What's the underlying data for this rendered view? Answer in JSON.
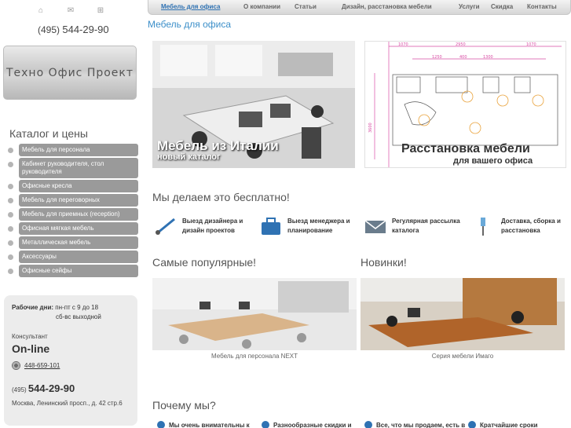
{
  "sidebar": {
    "phone_prefix": "(495)",
    "phone_number": "544-29-90",
    "logo_text": "Техно Офис Проект",
    "catalog_title": "Каталог и цены",
    "menu": [
      "Мебель для персонала",
      "Кабинет руководителя, стол руководителя",
      "Офисные кресла",
      "Мебель для переговорных",
      "Мебель для приемных (reception)",
      "Офисная мягкая мебель",
      "Металлическая мебель",
      "Аксессуары",
      "Офисные сейфы"
    ],
    "hours_label": "Рабочие дни:",
    "hours_weekdays": "пн-пт с 9 до 18",
    "hours_weekend": "сб-вс выходной",
    "consultant_label": "Консультант",
    "online_label": "On-line",
    "icq_number": "448-659-101",
    "phone2_prefix": "(495)",
    "phone2_number": "544-29-90",
    "address": "Москва, Ленинский просп., д. 42 стр.6"
  },
  "topnav": {
    "items": [
      "Мебель для офиса",
      "О компании",
      "Статьи",
      "Дизайн, расстановка мебели",
      "Услуги",
      "Скидка",
      "Контакты"
    ]
  },
  "page_title": "Мебель для офиса",
  "banners": {
    "left_title": "Мебель из Италии",
    "left_subtitle": "новый каталог",
    "right_title": "Расстановка мебели",
    "right_subtitle": "для вашего офиса",
    "plan_dims": [
      "1070",
      "2950",
      "1070",
      "1250",
      "400",
      "1300",
      "3600"
    ]
  },
  "free": {
    "heading": "Мы делаем это бесплатно!",
    "services": [
      "Выезд дизайнера и дизайн проектов",
      "Выезд менеджера и планирование",
      "Регулярная рассылка каталога",
      "Доставка, сборка и расстановка"
    ]
  },
  "popular": {
    "heading": "Самые популярные!",
    "caption": "Мебель для персонала NEXT"
  },
  "novelties": {
    "heading": "Новинки!",
    "caption": "Серия мебели Имаго"
  },
  "why": {
    "heading": "Почему мы?",
    "items": [
      "Мы очень внимательны к",
      "Разнообразные скидки и",
      "Все, что мы продаем, есть в",
      "Кратчайшие сроки"
    ]
  }
}
